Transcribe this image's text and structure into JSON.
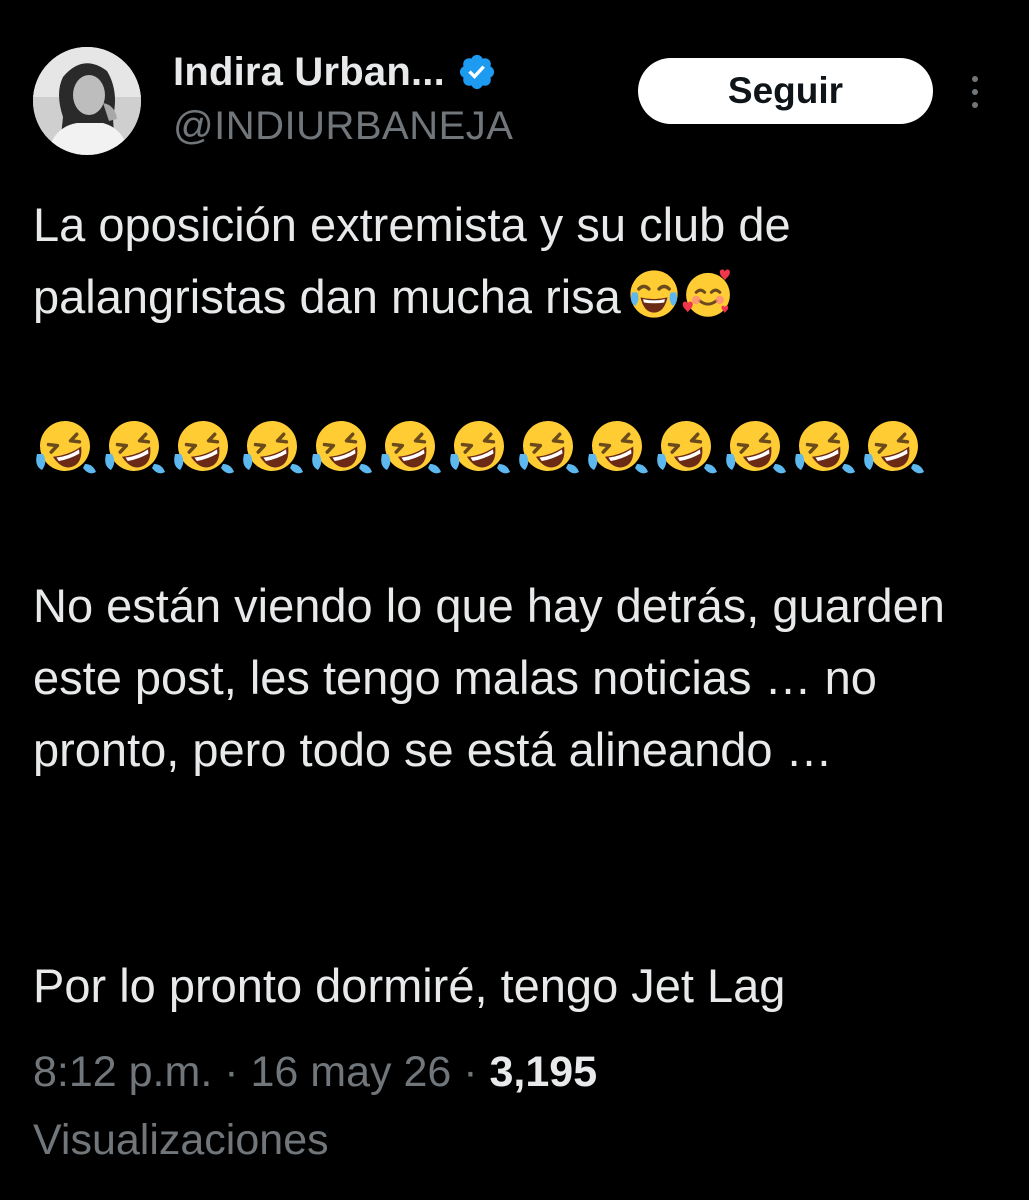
{
  "author": {
    "display_name": "Indira Urban...",
    "handle": "@INDIURBANEJA",
    "verified": true,
    "badge_color": "#1d9bf0"
  },
  "actions": {
    "follow_label": "Seguir",
    "more_icon": "more-vertical-icon"
  },
  "tweet": {
    "paragraph_1": "La oposición extremista y su club de palangristas dan mucha risa",
    "paragraph_1_emojis": [
      "face-with-tears-of-joy-icon",
      "smiling-face-with-hearts-icon"
    ],
    "paragraph_2_emoji": "rolling-on-the-floor-laughing-icon",
    "paragraph_2_emoji_count": 13,
    "paragraph_3": "No están viendo lo que hay detrás, guarden este post, les tengo malas noticias … no pronto, pero todo se está alineando …",
    "paragraph_4": "Por lo pronto dormiré, tengo Jet Lag"
  },
  "meta": {
    "time": "8:12 p.m.",
    "separator": " · ",
    "date": "16 may 26",
    "views_count": "3,195",
    "views_label": "Visualizaciones"
  },
  "colors": {
    "background": "#000000",
    "primary_text": "#e7e9ea",
    "secondary_text": "#71767b",
    "button_bg": "#ffffff",
    "button_text": "#0f1419"
  }
}
